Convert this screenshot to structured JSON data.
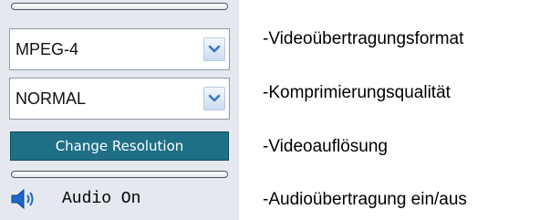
{
  "controls": {
    "format_value": "MPEG-4",
    "quality_value": "NORMAL",
    "resolution_button_label": "Change Resolution",
    "audio_label": "Audio On"
  },
  "descriptions": {
    "format": "-Videoübertragungsformat",
    "quality": "-Komprimierungsqualität",
    "resolution": "-Videoauflösung",
    "audio": "-Audioübertragung ein/aus"
  },
  "icons": {
    "dropdown": "chevron-down-icon",
    "speaker": "speaker-icon"
  },
  "colors": {
    "panel_background": "#e5e8ee",
    "resolution_button": "#1f6f86",
    "chevron": "#3b73c2",
    "speaker": "#1f66c8"
  }
}
